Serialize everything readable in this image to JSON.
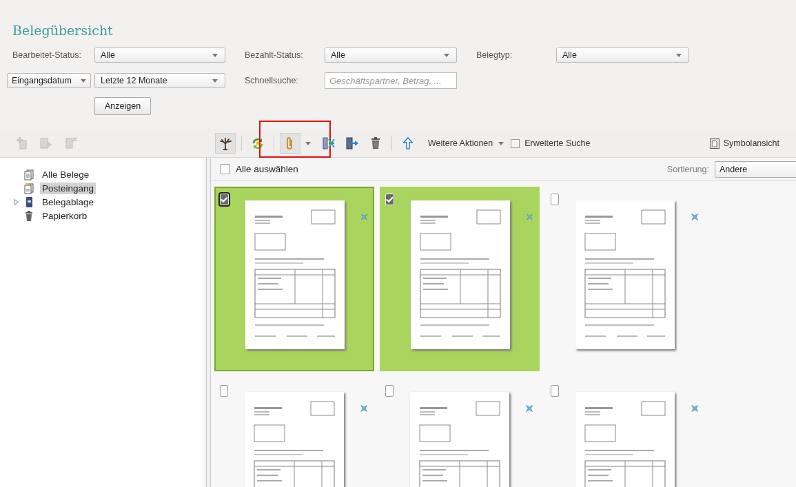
{
  "header": {
    "title": "Belegübersicht"
  },
  "filters": {
    "rows": [
      {
        "label": "Bearbeitet-Status:",
        "value": "Alle"
      },
      {
        "label": "Bezahlt-Status:",
        "value": "Alle"
      },
      {
        "label": "Belegtyp:",
        "value": "Alle"
      }
    ],
    "date_field": "Eingangsdatum",
    "date_range": "Letzte 12 Monate",
    "quick_search": {
      "label": "Schnellsuche:",
      "placeholder": "Geschäftspartner, Betrag, ..."
    },
    "show_button": "Anzeigen"
  },
  "toolbar": {
    "left_buttons": [
      {
        "disabled": true
      },
      {
        "disabled": true
      },
      {
        "disabled": true
      }
    ],
    "buttons": [
      {
        "pressed": true,
        "dropdown": false,
        "highlighted": false
      },
      {
        "pressed": false,
        "dropdown": false,
        "highlighted": false
      },
      {
        "pressed": true,
        "dropdown": true,
        "highlighted": true
      },
      {
        "pressed": false,
        "dropdown": false,
        "highlighted": false
      },
      {
        "pressed": false,
        "dropdown": false,
        "highlighted": false
      },
      {
        "pressed": false,
        "dropdown": false,
        "highlighted": false
      },
      {
        "pressed": false,
        "dropdown": false,
        "highlighted": false
      }
    ],
    "more_actions": "Weitere Aktionen",
    "advanced_search": {
      "label": "Erweiterte Suche",
      "checked": false
    },
    "view_toggle": "Symbolansicht"
  },
  "tree": {
    "items": [
      {
        "label": "Alle Belege",
        "selected": false
      },
      {
        "label": "Posteingang",
        "selected": true
      },
      {
        "label": "Belegablage",
        "selected": false,
        "expanded": false
      },
      {
        "label": "Papierkorb",
        "selected": false
      }
    ]
  },
  "grid": {
    "select_all": {
      "label": "Alle auswählen",
      "checked": false
    },
    "sort_label": "Sortierung:",
    "sort_value": "Andere"
  },
  "tiles": [
    {
      "selected": true,
      "focused": true
    },
    {
      "selected": true,
      "focused": false
    },
    {
      "selected": false,
      "focused": false
    },
    {
      "selected": false,
      "focused": false
    },
    {
      "selected": false,
      "focused": false
    },
    {
      "selected": false,
      "focused": false
    }
  ]
}
